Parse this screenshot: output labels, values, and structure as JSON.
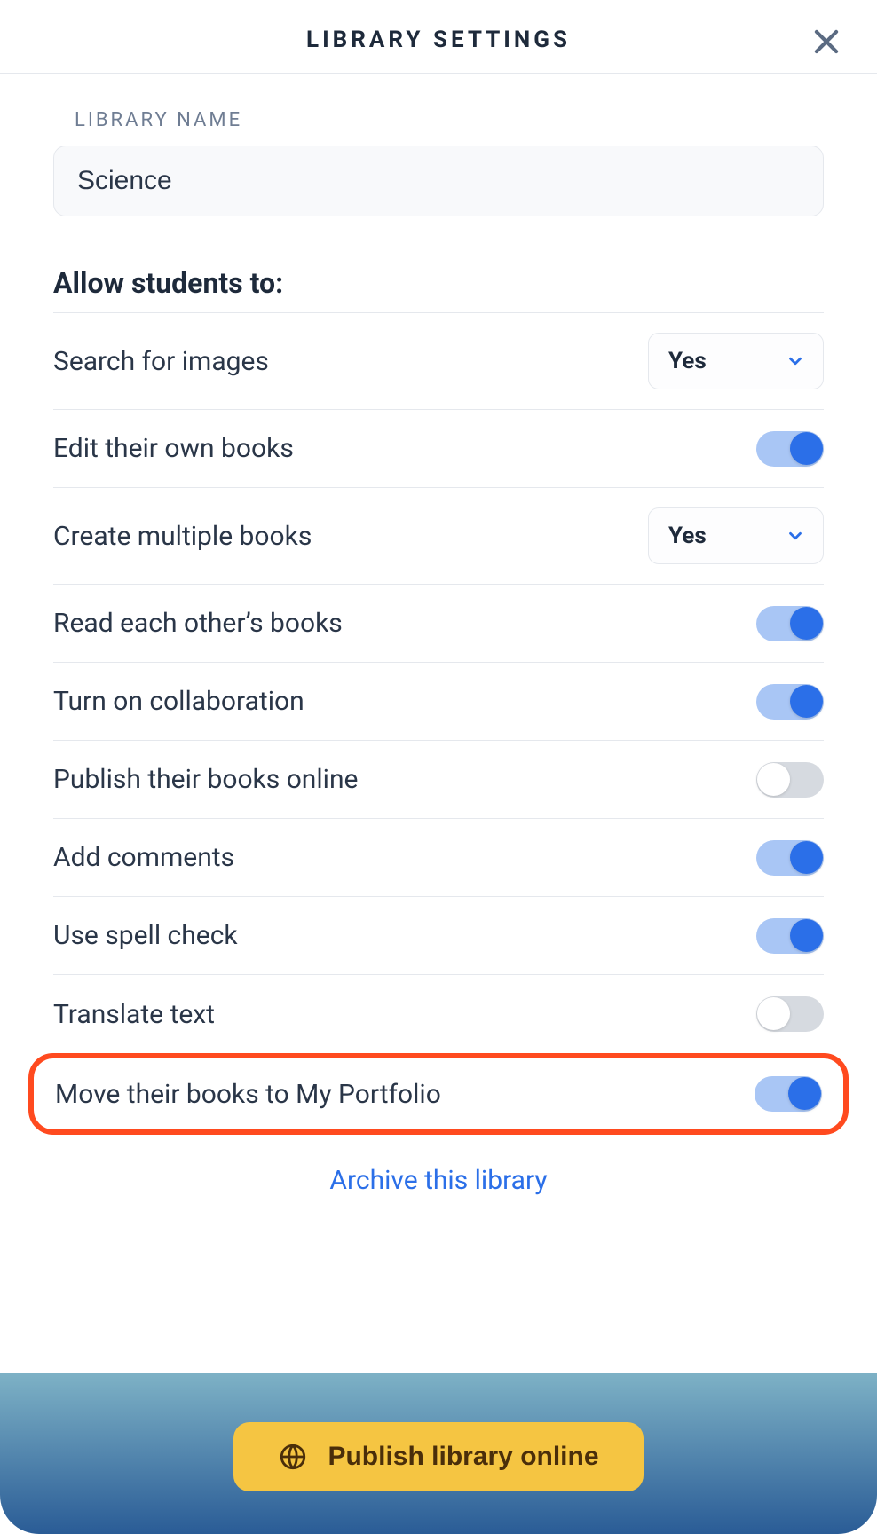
{
  "header": {
    "title": "LIBRARY SETTINGS"
  },
  "libraryName": {
    "label": "LIBRARY NAME",
    "value": "Science"
  },
  "sectionTitle": "Allow students to:",
  "settings": {
    "searchImages": {
      "label": "Search for images",
      "value": "Yes"
    },
    "editBooks": {
      "label": "Edit their own books",
      "on": true
    },
    "createMultiple": {
      "label": "Create multiple books",
      "value": "Yes"
    },
    "readOthers": {
      "label": "Read each other’s books",
      "on": true
    },
    "collaboration": {
      "label": "Turn on collaboration",
      "on": true
    },
    "publishOnline": {
      "label": "Publish their books online",
      "on": false
    },
    "addComments": {
      "label": "Add comments",
      "on": true
    },
    "spellCheck": {
      "label": "Use spell check",
      "on": true
    },
    "translate": {
      "label": "Translate text",
      "on": false
    },
    "movePortfolio": {
      "label": "Move their books to My Portfolio",
      "on": true
    }
  },
  "links": {
    "archive": "Archive this library"
  },
  "footer": {
    "publish": "Publish library online"
  }
}
